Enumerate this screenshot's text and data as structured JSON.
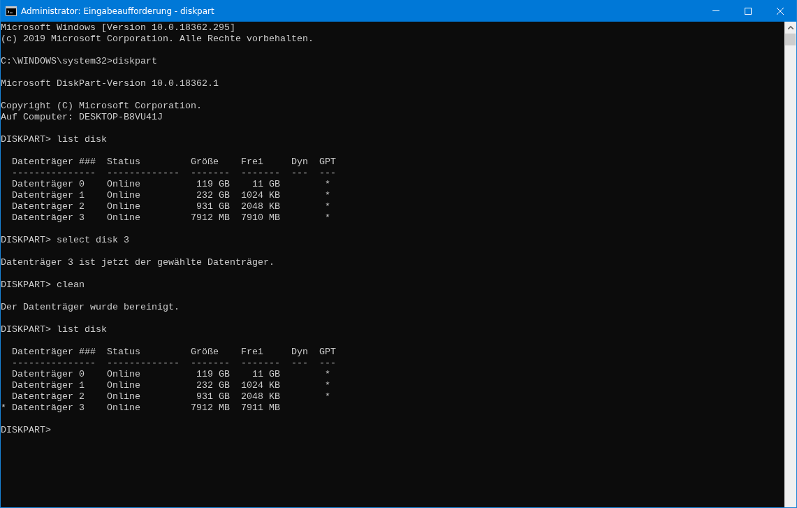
{
  "window": {
    "title": "Administrator: Eingabeaufforderung - diskpart"
  },
  "console": {
    "blocks": [
      [
        "Microsoft Windows [Version 10.0.18362.295]",
        "(c) 2019 Microsoft Corporation. Alle Rechte vorbehalten."
      ],
      [
        "C:\\WINDOWS\\system32>diskpart"
      ],
      [
        "Microsoft DiskPart-Version 10.0.18362.1"
      ],
      [
        "Copyright (C) Microsoft Corporation.",
        "Auf Computer: DESKTOP-B8VU41J"
      ],
      [
        "DISKPART> list disk"
      ],
      [
        "  Datenträger ###  Status         Größe    Frei     Dyn  GPT",
        "  ---------------  -------------  -------  -------  ---  ---",
        "  Datenträger 0    Online          119 GB    11 GB        *",
        "  Datenträger 1    Online          232 GB  1024 KB        *",
        "  Datenträger 2    Online          931 GB  2048 KB        *",
        "  Datenträger 3    Online         7912 MB  7910 MB        *"
      ],
      [
        "DISKPART> select disk 3"
      ],
      [
        "Datenträger 3 ist jetzt der gewählte Datenträger."
      ],
      [
        "DISKPART> clean"
      ],
      [
        "Der Datenträger wurde bereinigt."
      ],
      [
        "DISKPART> list disk"
      ],
      [
        "  Datenträger ###  Status         Größe    Frei     Dyn  GPT",
        "  ---------------  -------------  -------  -------  ---  ---",
        "  Datenträger 0    Online          119 GB    11 GB        *",
        "  Datenträger 1    Online          232 GB  1024 KB        *",
        "  Datenträger 2    Online          931 GB  2048 KB        *",
        "* Datenträger 3    Online         7912 MB  7911 MB"
      ],
      [
        "DISKPART>"
      ]
    ]
  }
}
